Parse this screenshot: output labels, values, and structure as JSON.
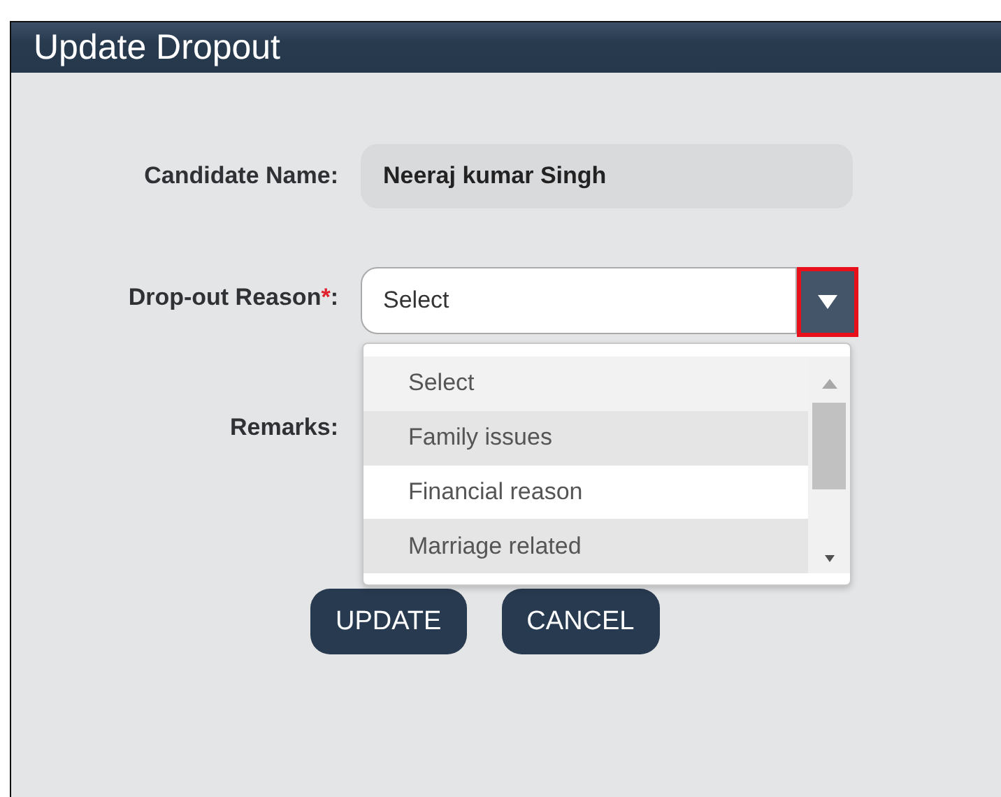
{
  "window": {
    "title": "Update Dropout"
  },
  "candidate": {
    "label": "Candidate Name:",
    "value": "Neeraj kumar Singh"
  },
  "reason": {
    "label": "Drop-out Reason",
    "required_mark": "*",
    "label_suffix": ":",
    "value": "Select",
    "expanded": true,
    "options": [
      {
        "label": "Select",
        "selected": true,
        "highlighted": false
      },
      {
        "label": "Family issues",
        "selected": false,
        "highlighted": true
      },
      {
        "label": "Financial reason",
        "selected": false,
        "highlighted": false
      },
      {
        "label": "Marriage related",
        "selected": false,
        "highlighted": true
      }
    ]
  },
  "remarks": {
    "label": "Remarks:"
  },
  "buttons": [
    "UPDATE",
    "CANCEL"
  ]
}
